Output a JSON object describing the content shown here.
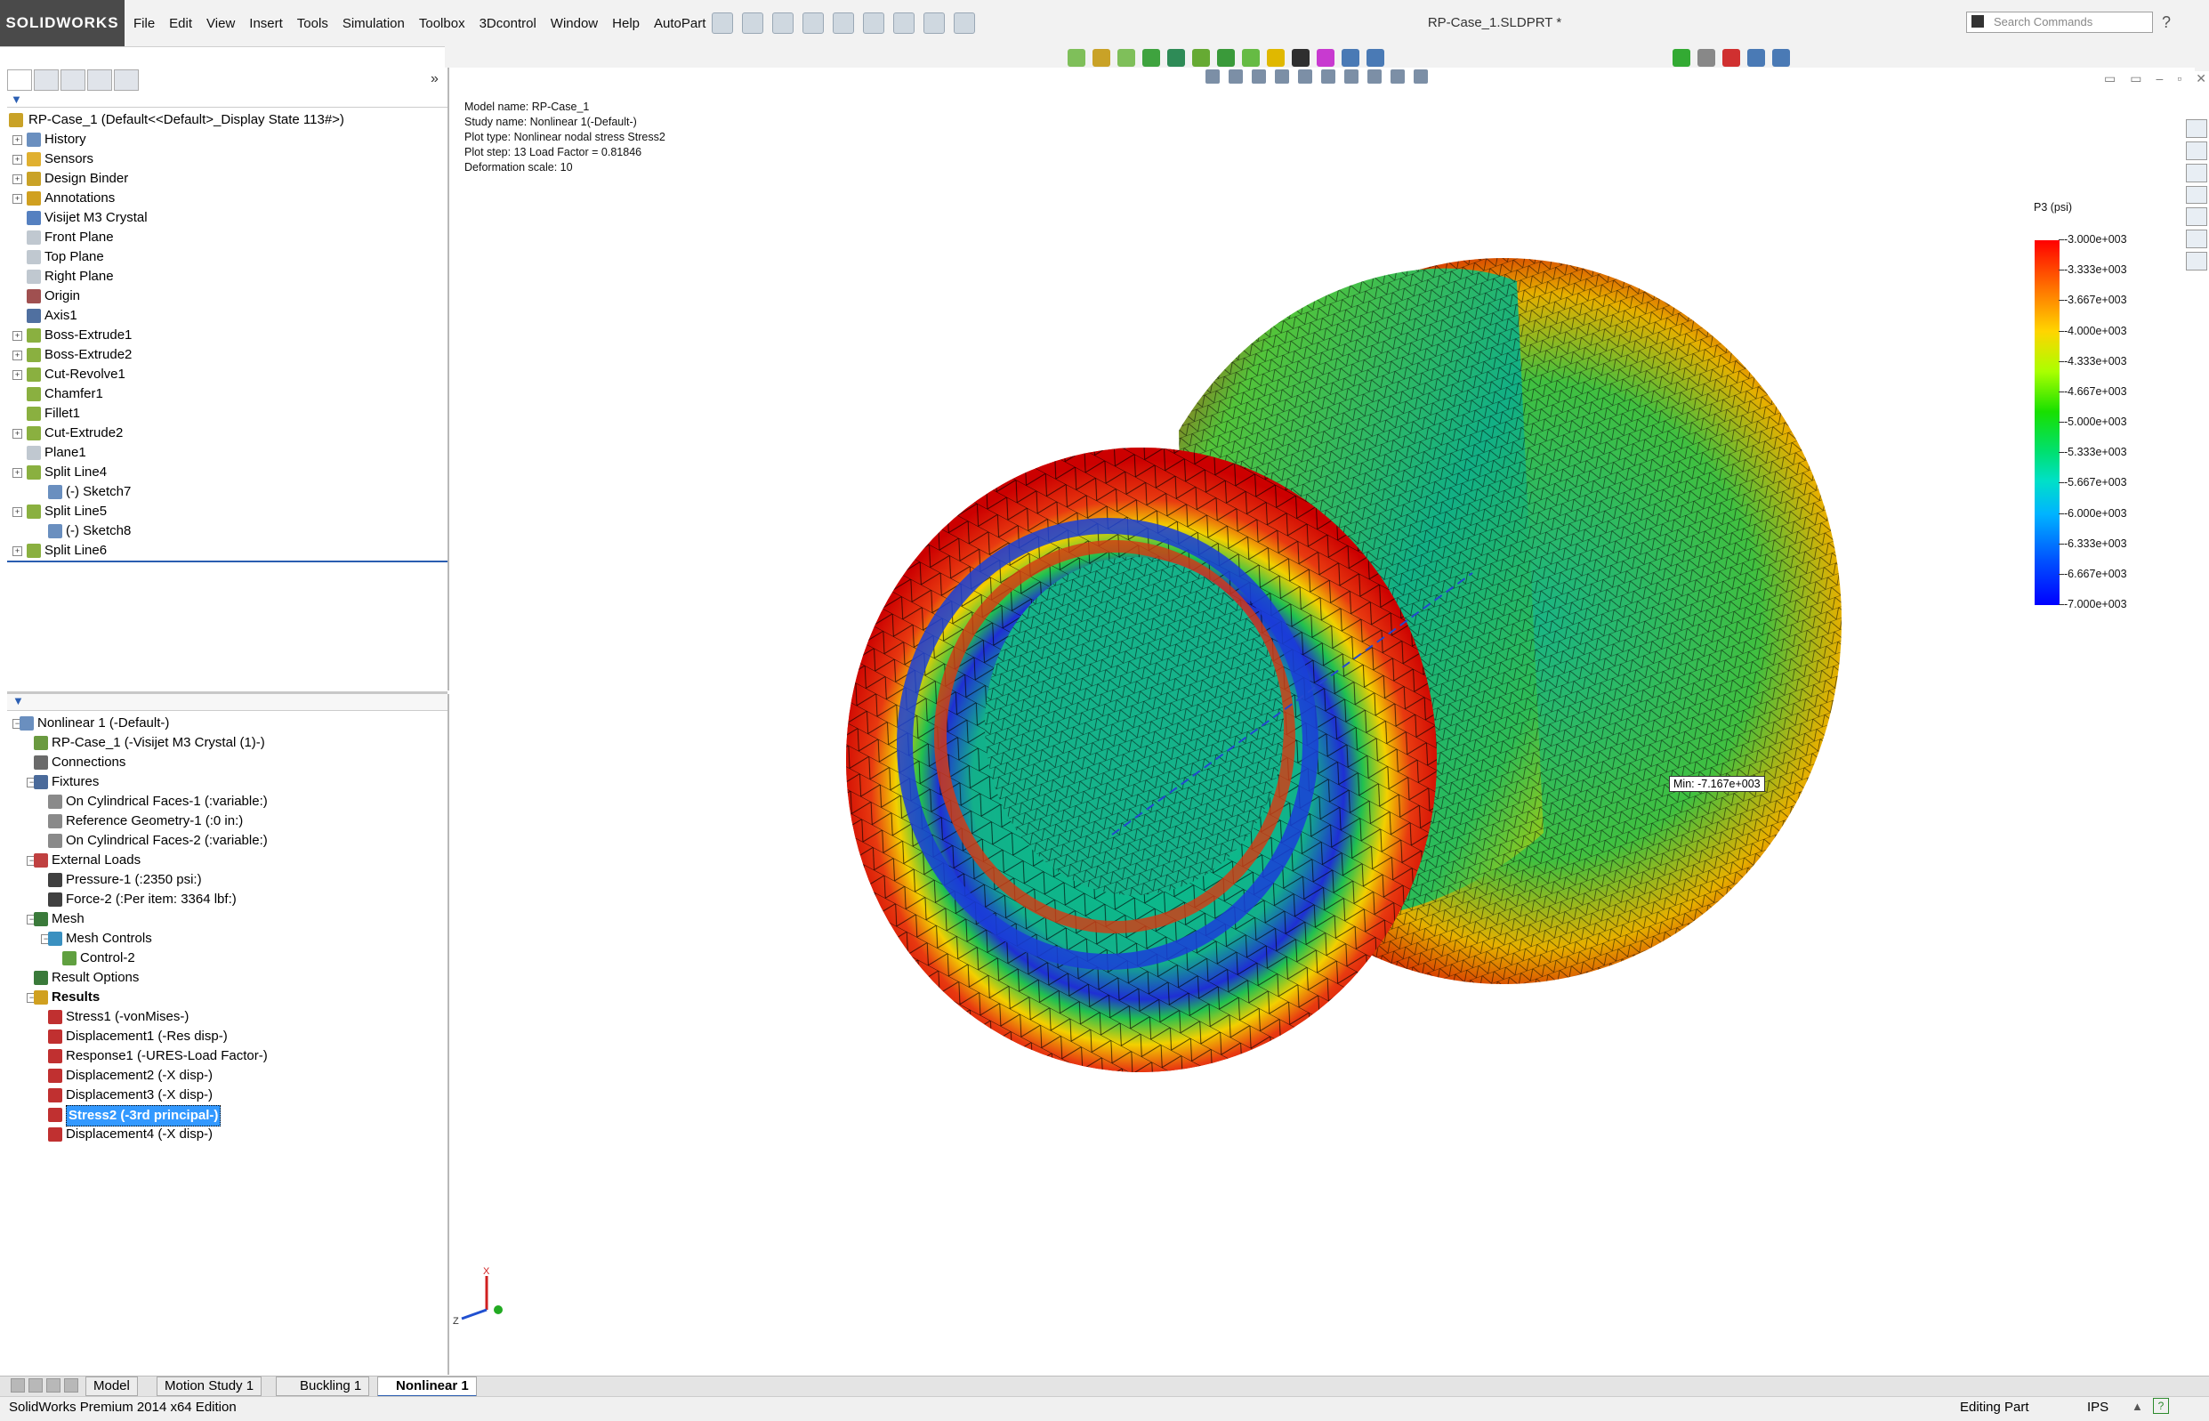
{
  "app": {
    "logo": "SOLIDWORKS",
    "menus": [
      "File",
      "Edit",
      "View",
      "Insert",
      "Tools",
      "Simulation",
      "Toolbox",
      "3Dcontrol",
      "Window",
      "Help",
      "AutoPart"
    ],
    "document_title": "RP-Case_1.SLDPRT *",
    "search_placeholder": "Search Commands"
  },
  "plot_info": {
    "model_name": "Model name: RP-Case_1",
    "study_name": "Study name: Nonlinear 1(-Default-)",
    "plot_type": "Plot type: Nonlinear nodal stress Stress2",
    "plot_step": "Plot step: 13    Load Factor = 0.81846",
    "deformation_scale": "Deformation scale: 10"
  },
  "legend": {
    "title": "P3 (psi)",
    "ticks": [
      "-3.000e+003",
      "-3.333e+003",
      "-3.667e+003",
      "-4.000e+003",
      "-4.333e+003",
      "-4.667e+003",
      "-5.000e+003",
      "-5.333e+003",
      "-5.667e+003",
      "-6.000e+003",
      "-6.333e+003",
      "-6.667e+003",
      "-7.000e+003"
    ],
    "colors": [
      "#ff0000",
      "#ff7a00",
      "#ffd500",
      "#aaff00",
      "#18e000",
      "#00e070",
      "#00e0c8",
      "#00b4ff",
      "#0050ff",
      "#0000ff"
    ]
  },
  "min_label": "Min: -7.167e+003",
  "feature_tree": {
    "root": "RP-Case_1  (Default<<Default>_Display State 113#>)",
    "items": [
      {
        "label": "History",
        "icon": "history-icon"
      },
      {
        "label": "Sensors",
        "icon": "sensor-icon"
      },
      {
        "label": "Design Binder",
        "icon": "binder-icon"
      },
      {
        "label": "Annotations",
        "icon": "annotations-icon"
      },
      {
        "label": "Visijet M3 Crystal",
        "icon": "material-icon"
      },
      {
        "label": "Front Plane",
        "icon": "plane-icon"
      },
      {
        "label": "Top Plane",
        "icon": "plane-icon"
      },
      {
        "label": "Right Plane",
        "icon": "plane-icon"
      },
      {
        "label": "Origin",
        "icon": "origin-icon"
      },
      {
        "label": "Axis1",
        "icon": "axis-icon"
      },
      {
        "label": "Boss-Extrude1",
        "icon": "extrude-icon"
      },
      {
        "label": "Boss-Extrude2",
        "icon": "extrude-icon"
      },
      {
        "label": "Cut-Revolve1",
        "icon": "revolve-icon"
      },
      {
        "label": "Chamfer1",
        "icon": "chamfer-icon"
      },
      {
        "label": "Fillet1",
        "icon": "fillet-icon"
      },
      {
        "label": "Cut-Extrude2",
        "icon": "extrude-icon"
      },
      {
        "label": "Plane1",
        "icon": "plane-icon"
      },
      {
        "label": "Split Line4",
        "icon": "splitline-icon"
      },
      {
        "label": "(-) Sketch7",
        "icon": "sketch-icon"
      },
      {
        "label": "Split Line5",
        "icon": "splitline-icon"
      },
      {
        "label": "(-) Sketch8",
        "icon": "sketch-icon"
      },
      {
        "label": "Split Line6",
        "icon": "splitline-icon"
      }
    ]
  },
  "sim_tree": {
    "items": [
      {
        "label": "Nonlinear 1 (-Default-)",
        "bold": false
      },
      {
        "label": "RP-Case_1 (-Visijet M3 Crystal (1)-)",
        "bold": false
      },
      {
        "label": "Connections",
        "bold": false
      },
      {
        "label": "Fixtures",
        "bold": false
      },
      {
        "label": "On Cylindrical Faces-1 (:variable:)",
        "bold": false
      },
      {
        "label": "Reference Geometry-1 (:0 in:)",
        "bold": false
      },
      {
        "label": "On Cylindrical Faces-2 (:variable:)",
        "bold": false
      },
      {
        "label": "External Loads",
        "bold": false
      },
      {
        "label": "Pressure-1 (:2350 psi:)",
        "bold": false
      },
      {
        "label": "Force-2 (:Per item: 3364 lbf:)",
        "bold": false
      },
      {
        "label": "Mesh",
        "bold": false
      },
      {
        "label": "Mesh Controls",
        "bold": false
      },
      {
        "label": "Control-2",
        "bold": false
      },
      {
        "label": "Result Options",
        "bold": false
      },
      {
        "label": "Results",
        "bold": true
      },
      {
        "label": "Stress1 (-vonMises-)",
        "bold": false
      },
      {
        "label": "Displacement1 (-Res disp-)",
        "bold": false
      },
      {
        "label": "Response1 (-URES-Load Factor-)",
        "bold": false
      },
      {
        "label": "Displacement2 (-X disp-)",
        "bold": false
      },
      {
        "label": "Displacement3 (-X disp-)",
        "bold": false
      },
      {
        "label": "Stress2 (-3rd principal-)",
        "bold": false,
        "selected": true
      },
      {
        "label": "Displacement4 (-X disp-)",
        "bold": false
      }
    ]
  },
  "bottom_tabs": [
    "Model",
    "Motion Study 1",
    "Buckling 1",
    "Nonlinear 1"
  ],
  "active_tab": "Nonlinear 1",
  "triad": {
    "x": "X",
    "z": "Z"
  },
  "status": {
    "left": "SolidWorks Premium 2014 x64 Edition",
    "editing": "Editing Part",
    "units": "IPS"
  }
}
